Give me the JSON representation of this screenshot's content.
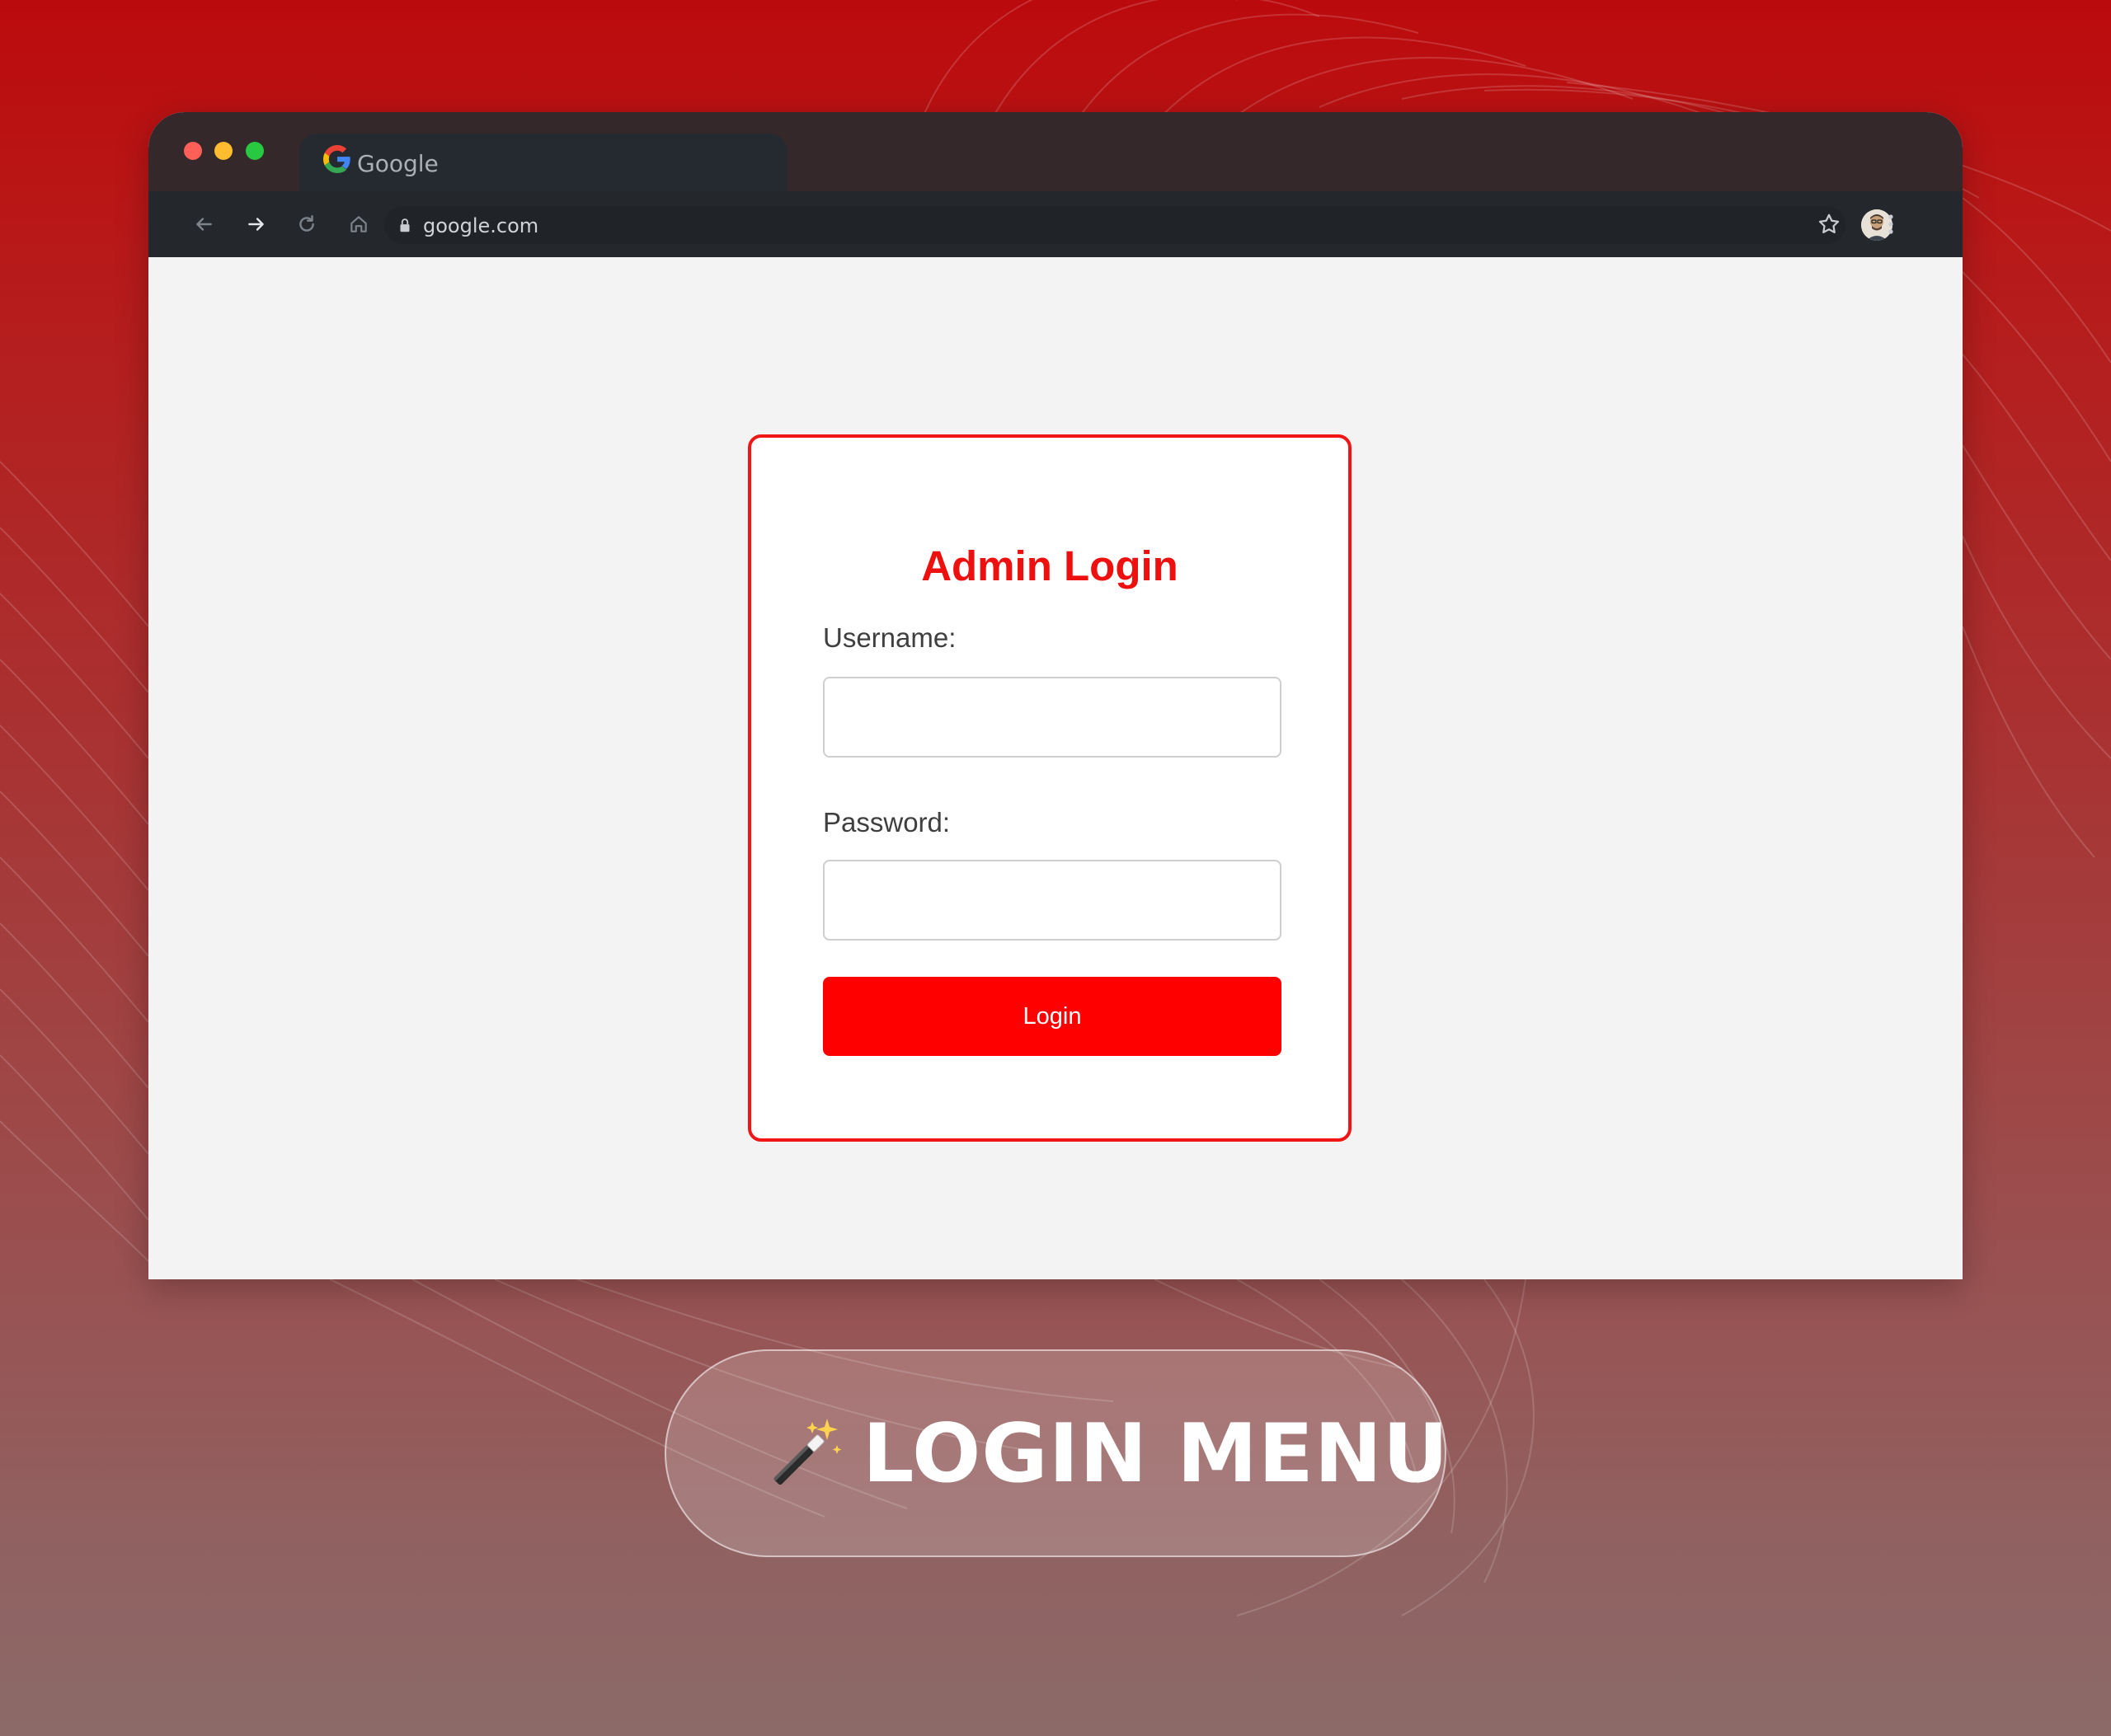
{
  "browser": {
    "tab_title": "Google",
    "url": "google.com"
  },
  "login_form": {
    "title": "Admin Login",
    "username_label": "Username:",
    "username_value": "",
    "password_label": "Password:",
    "password_value": "",
    "submit_label": "Login"
  },
  "banner": {
    "label": "LOGIN MENU"
  },
  "colors": {
    "accent": "#fe0000",
    "background_top": "#bb0a0d",
    "background_bottom": "#8b6a67",
    "browser_chrome": "#24282d"
  },
  "icons": {
    "banner_icon": "magic-wand-icon"
  }
}
